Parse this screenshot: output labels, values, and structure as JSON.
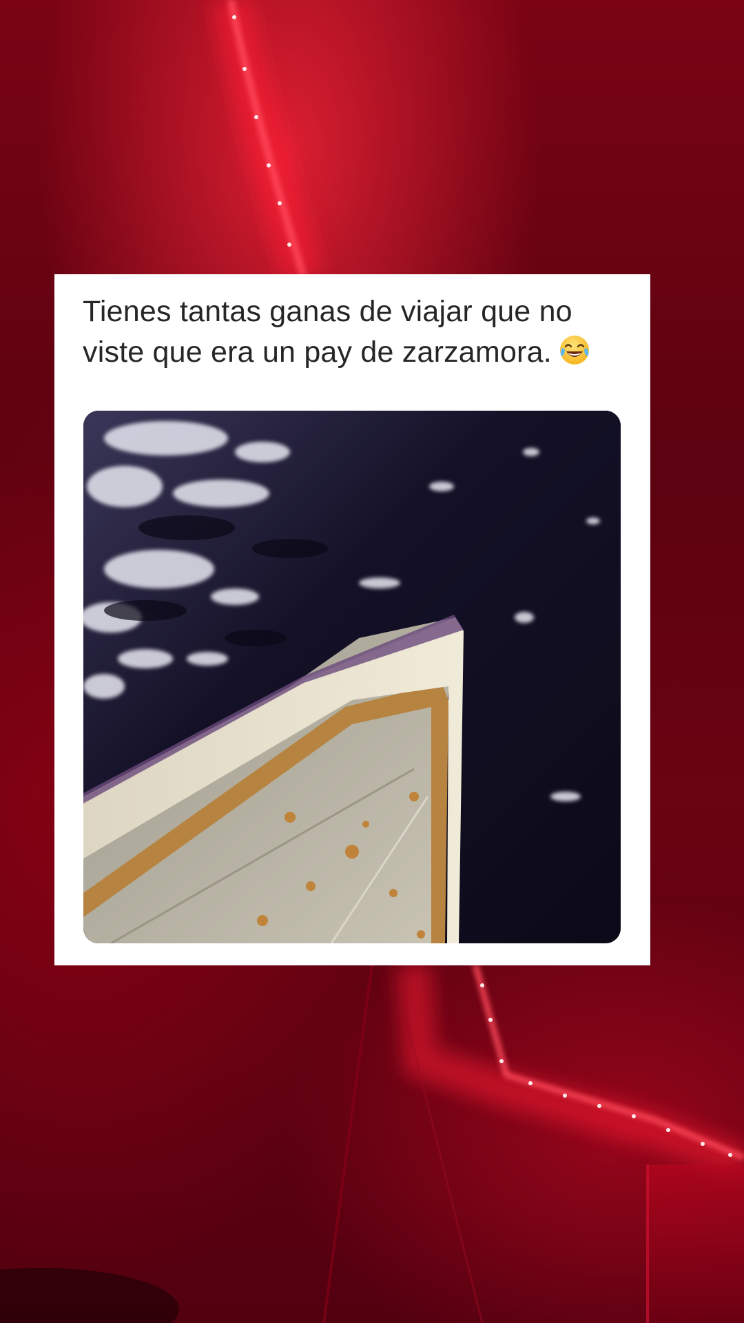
{
  "post": {
    "caption": "Tienes tantas ganas de viajar que no viste que era un pay de zarzamora.",
    "emoji_icon": "face-with-tears-of-joy-icon"
  },
  "photo": {
    "subject_icon": "blackberry-pie-photo"
  },
  "colors": {
    "background": "#6a0312",
    "led_light": "#ff2a3a",
    "card": "#ffffff",
    "caption_text": "#262626"
  }
}
